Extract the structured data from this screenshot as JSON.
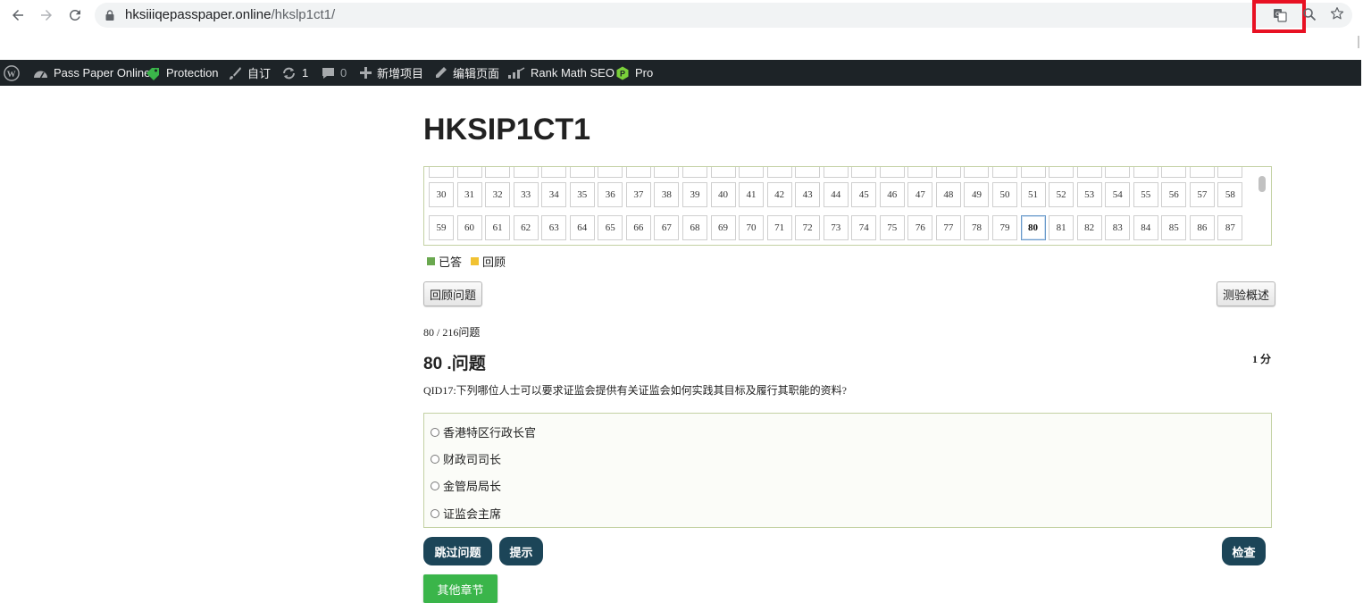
{
  "browser": {
    "url_domain": "hksiiiqepasspaper.online",
    "url_path": "/hkslp1ct1/"
  },
  "adminbar": {
    "site_name": "Pass Paper Online",
    "protection": "Protection",
    "customize": "自订",
    "updates_count": "1",
    "comments_count": "0",
    "new_item": "新增项目",
    "edit_page": "编辑页面",
    "rank_math": "Rank Math SEO",
    "pro": "Pro"
  },
  "page": {
    "title": "HKSIP1CT1"
  },
  "question_list": {
    "row2": [
      "30",
      "31",
      "32",
      "33",
      "34",
      "35",
      "36",
      "37",
      "38",
      "39",
      "40",
      "41",
      "42",
      "43",
      "44",
      "45",
      "46",
      "47",
      "48",
      "49",
      "50",
      "51",
      "52",
      "53",
      "54",
      "55",
      "56",
      "57",
      "58"
    ],
    "row3": [
      "59",
      "60",
      "61",
      "62",
      "63",
      "64",
      "65",
      "66",
      "67",
      "68",
      "69",
      "70",
      "71",
      "72",
      "73",
      "74",
      "75",
      "76",
      "77",
      "78",
      "79",
      "80",
      "81",
      "82",
      "83",
      "84",
      "85",
      "86",
      "87"
    ],
    "current": "80"
  },
  "legend": {
    "answered": "已答",
    "review": "回顾",
    "answered_color": "#6aa84f",
    "review_color": "#f1c232"
  },
  "buttons": {
    "review_question": "回顾问题",
    "quiz_summary": "测验概述",
    "skip": "跳过问题",
    "hint": "提示",
    "check": "检查",
    "other_chapters": "其他章节"
  },
  "question": {
    "progress": "80 / 216问题",
    "heading": "80 .问题",
    "points": "1 分",
    "text": "QID17:下列哪位人士可以要求证监会提供有关证监会如何实践其目标及履行其职能的资料?",
    "answers": [
      "香港特区行政长官",
      "财政司司长",
      "金管局局长",
      "证监会主席"
    ]
  }
}
